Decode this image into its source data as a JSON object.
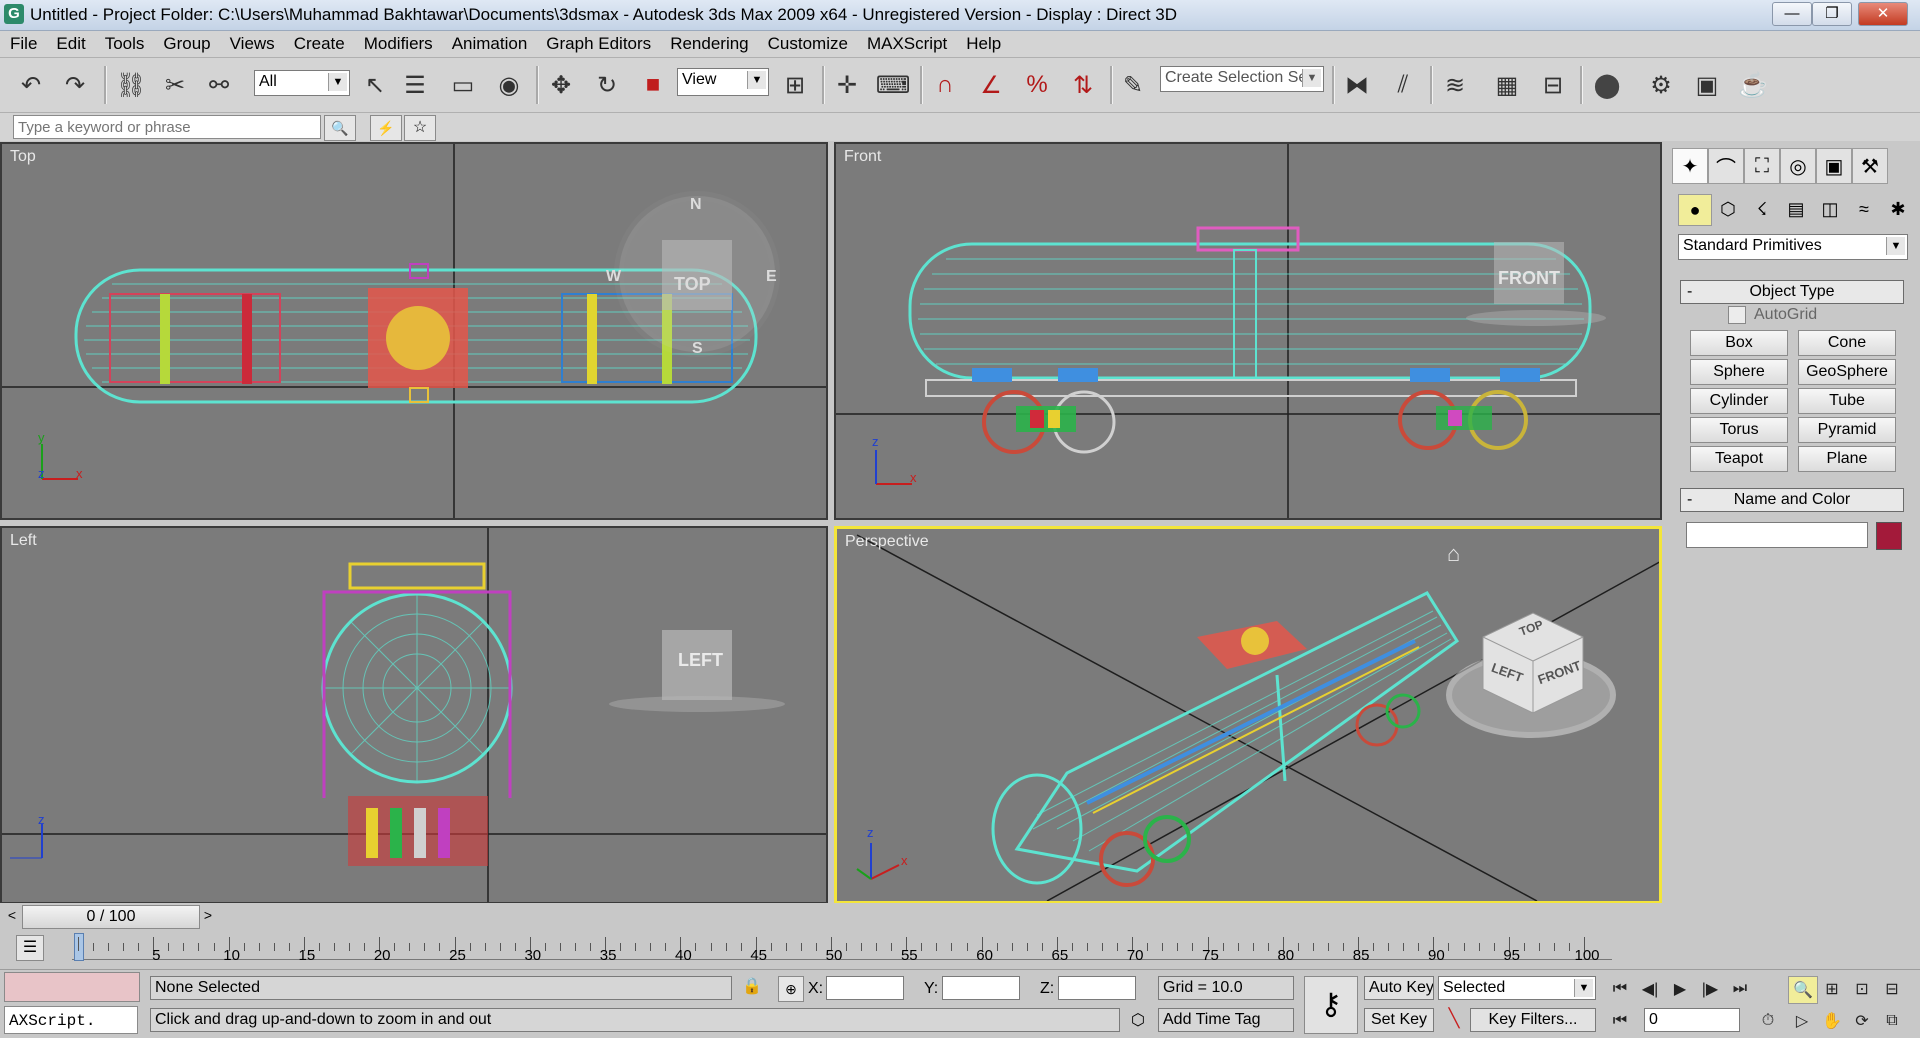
{
  "window": {
    "title": "Untitled      - Project Folder: C:\\Users\\Muhammad Bakhtawar\\Documents\\3dsmax     - Autodesk 3ds Max  2009 x64  - Unregistered Version     - Display : Direct 3D",
    "app_glyph": "G",
    "minimize_glyph": "—",
    "maximize_glyph": "❐",
    "close_glyph": "✕"
  },
  "menu": [
    "File",
    "Edit",
    "Tools",
    "Group",
    "Views",
    "Create",
    "Modifiers",
    "Animation",
    "Graph Editors",
    "Rendering",
    "Customize",
    "MAXScript",
    "Help"
  ],
  "toolbar": {
    "filter_value": "All",
    "refcoord_value": "View",
    "selection_set_placeholder": "Create Selection Set",
    "icons": {
      "undo": "↶",
      "redo": "↷",
      "link": "⛓",
      "unlink": "✂",
      "bind": "⚯",
      "select": "↖",
      "select_by_name": "☰",
      "rect_select": "▭",
      "window_crossing": "◉",
      "move": "✥",
      "rotate": "↻",
      "scale": "■",
      "pivot": "⊞",
      "manipulate": "✛",
      "keyboard_shortcut": "⌨",
      "snap": "∩",
      "angle_snap": "∠",
      "percent_snap": "%",
      "spinner_snap": "⇅",
      "edit_named": "✎",
      "mirror": "⧓",
      "align": "⫽",
      "layers": "≋",
      "curve_editor": "▦",
      "schematic": "⊟",
      "material_editor": "⬤",
      "render_setup": "⚙",
      "rendered_frame": "▣",
      "render": "☕"
    }
  },
  "search": {
    "placeholder": "Type a keyword or phrase",
    "search_icon": "🔍",
    "star_icon": "☆",
    "bookmark_icon": "⚡"
  },
  "viewports": {
    "top": {
      "label": "Top",
      "cube_label": "TOP"
    },
    "front": {
      "label": "Front",
      "cube_label": "FRONT"
    },
    "left": {
      "label": "Left",
      "cube_label": "LEFT"
    },
    "perspective": {
      "label": "Perspective",
      "cube_top": "TOP",
      "cube_left": "LEFT",
      "cube_front": "FRONT",
      "home_icon": "⌂"
    }
  },
  "compass": {
    "north": "N",
    "west": "W",
    "east": "E",
    "south": "S"
  },
  "axis": {
    "x": "x",
    "y": "y",
    "z": "z"
  },
  "command_panel": {
    "tabs": [
      "✦",
      "⌒",
      "⛶",
      "◎",
      "▣",
      "⚒"
    ],
    "subtabs": [
      "●",
      "⬡",
      "☇",
      "▤",
      "◫",
      "≈",
      "✱"
    ],
    "category": "Standard Primitives",
    "object_type_title": "Object Type",
    "autogrid_label": "AutoGrid",
    "buttons": [
      "Box",
      "Cone",
      "Sphere",
      "GeoSphere",
      "Cylinder",
      "Tube",
      "Torus",
      "Pyramid",
      "Teapot",
      "Plane"
    ],
    "name_color_title": "Name and Color",
    "rollout_minus": "-",
    "color_swatch": "#a31a3a"
  },
  "timeline": {
    "frame_label": "0 / 100",
    "prev_glyph": "<",
    "next_glyph": ">",
    "ticks": [
      5,
      10,
      15,
      20,
      25,
      30,
      35,
      40,
      45,
      50,
      55,
      60,
      65,
      70,
      75,
      80,
      85,
      90,
      95,
      100
    ]
  },
  "status": {
    "selection": "None Selected",
    "prompt": "Click and drag up-and-down to zoom in and out",
    "maxscript": "AXScript.",
    "x_label": "X:",
    "y_label": "Y:",
    "z_label": "Z:",
    "grid": "Grid = 10.0",
    "add_time_tag": "Add Time Tag",
    "auto_key": "Auto Key",
    "set_key": "Set Key",
    "key_mode_value": "Selected",
    "key_filters": "Key Filters...",
    "frame_value": "0",
    "lock_icon": "🔒",
    "key_icon": "⚷",
    "playback": [
      "⏮",
      "◀|",
      "▶",
      "|▶",
      "⏭"
    ],
    "nav": [
      "🔍",
      "⊞",
      "⊡",
      "⊟",
      "▷",
      "✋",
      "⟳",
      "⧉"
    ]
  }
}
